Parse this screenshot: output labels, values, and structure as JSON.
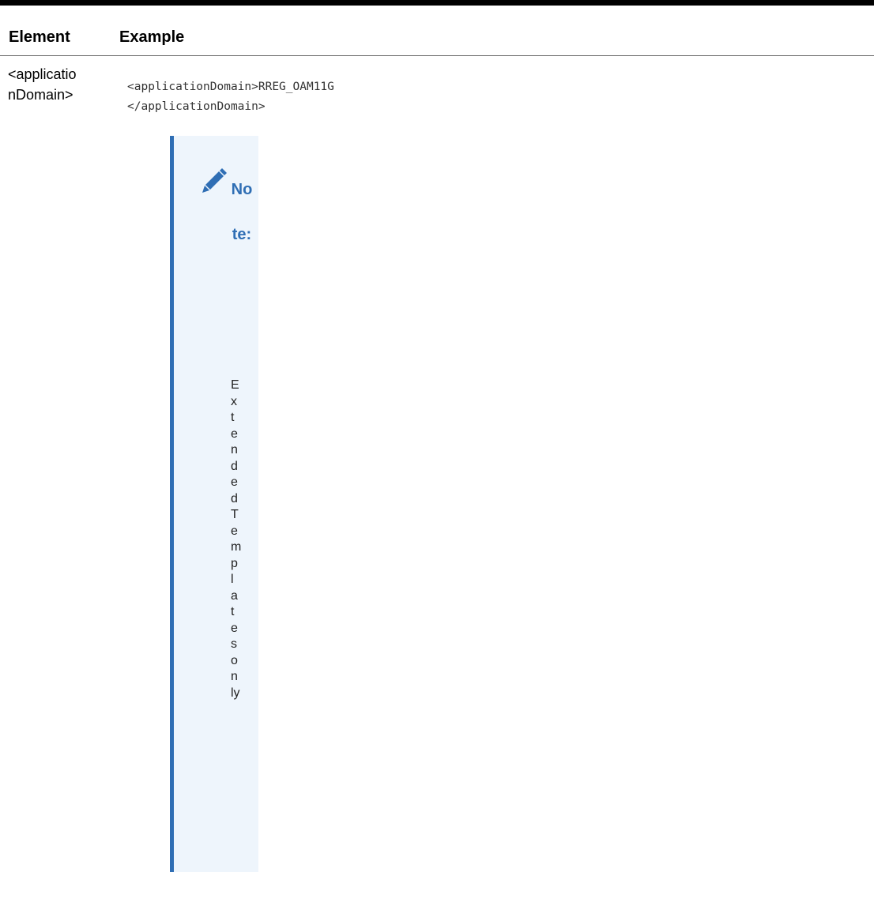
{
  "table": {
    "headers": {
      "element": "Element",
      "example": "Example"
    },
    "row": {
      "element_lines": [
        "<applicatio",
        "nDomain>"
      ],
      "example_lines": [
        "<applicationDomain>RREG_OAM11G",
        "</applicationDomain>"
      ]
    }
  },
  "note": {
    "icon": "pencil-icon",
    "label": "Note:",
    "text": "ExtendedTemplates only"
  },
  "colors": {
    "accent": "#2f6eb4",
    "note_background": "#eef5fc",
    "rule": "#000000"
  }
}
